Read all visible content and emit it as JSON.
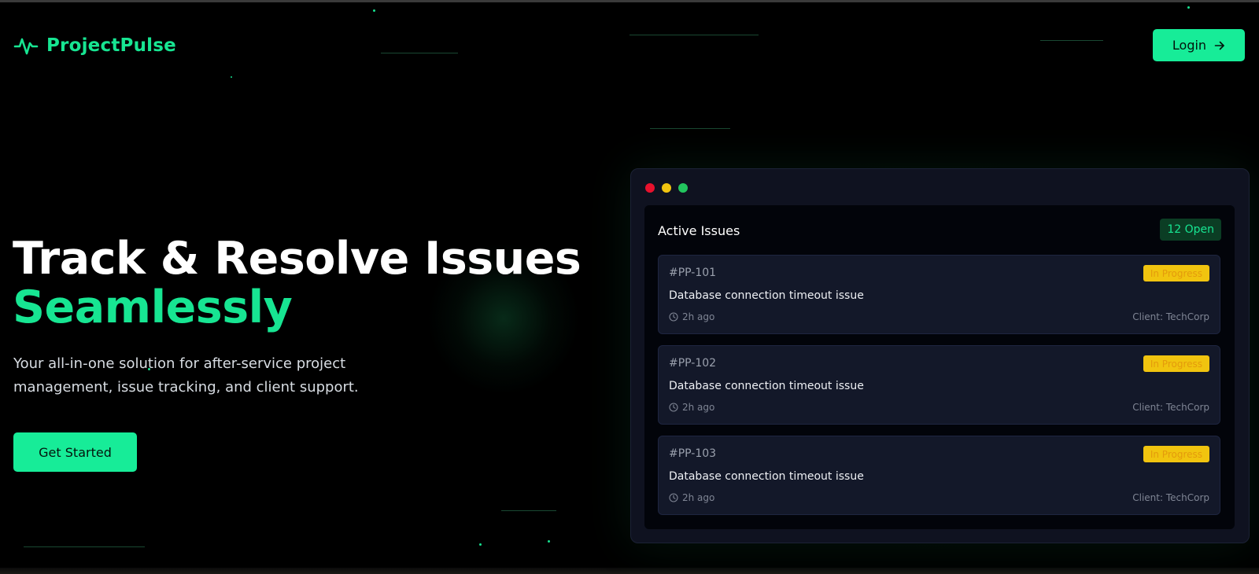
{
  "brand": {
    "name": "ProjectPulse",
    "icon": "pulse-icon",
    "accent_color": "#17E592"
  },
  "header": {
    "login_label": "Login",
    "login_icon": "arrow-right-icon"
  },
  "hero": {
    "title_line1": "Track & Resolve Issues",
    "title_line2": "Seamlessly",
    "subtitle": "Your all-in-one solution for after-service project management, issue tracking, and client support.",
    "cta_label": "Get Started"
  },
  "issues_window": {
    "window_controls": [
      "red",
      "yellow",
      "green"
    ],
    "title": "Active Issues",
    "open_count": "12 Open",
    "issues": [
      {
        "id": "#PP-101",
        "status": "In Progress",
        "description": "Database connection timeout issue",
        "time": "2h ago",
        "client": "Client: TechCorp"
      },
      {
        "id": "#PP-102",
        "status": "In Progress",
        "description": "Database connection timeout issue",
        "time": "2h ago",
        "client": "Client: TechCorp"
      },
      {
        "id": "#PP-103",
        "status": "In Progress",
        "description": "Database connection timeout issue",
        "time": "2h ago",
        "client": "Client: TechCorp"
      }
    ],
    "status_color": "#F1C40F"
  }
}
